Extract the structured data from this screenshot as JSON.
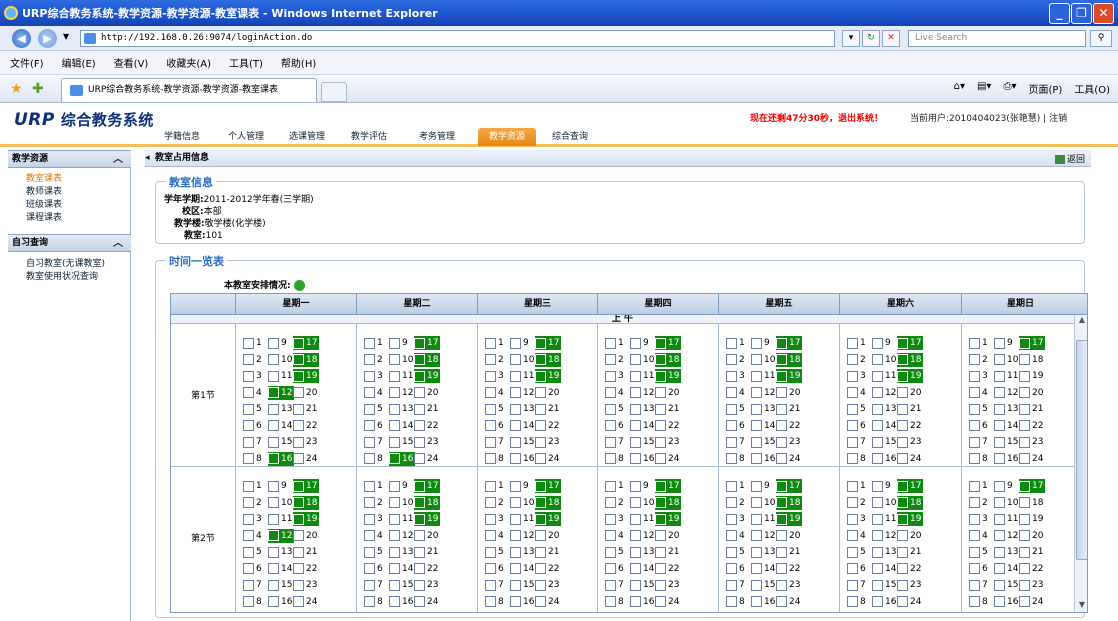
{
  "window": {
    "title": "URP综合教务系统-教学资源-教学资源-教室课表 - Windows Internet Explorer",
    "url": "http://192.168.0.26:9074/loginAction.do",
    "search_placeholder": "Live Search",
    "tab_title": "URP综合教务系统-教学资源-教学资源-教室课表",
    "menu": [
      "文件(F)",
      "编辑(E)",
      "查看(V)",
      "收藏夹(A)",
      "工具(T)",
      "帮助(H)"
    ],
    "toolbar": {
      "page": "页面(P)",
      "tools": "工具(O)"
    }
  },
  "app": {
    "logo_latin": "URP",
    "logo_cn": "综合教务系统",
    "warning": "现在还剩47分30秒，退出系统！",
    "user_text": "当前用户:2010404023(张艳慧) | 注销",
    "nav": [
      "学籍信息",
      "个人管理",
      "选课管理",
      "教学评估",
      "考务管理",
      "教学资源",
      "综合查询"
    ],
    "active_nav": "教学资源"
  },
  "sidebar": {
    "section1_title": "教学资源",
    "section1_items": [
      "教室课表",
      "教师课表",
      "班级课表",
      "课程课表"
    ],
    "section2_title": "自习查询",
    "section2_items": [
      "自习教室(无课教室)",
      "教室使用状况查询"
    ],
    "active_item": "教室课表"
  },
  "content": {
    "header": "教室占用信息",
    "back": "返回",
    "info_legend": "教室信息",
    "term_label": "学年学期:",
    "term": "2011-2012学年春(三学期)",
    "campus_label": "校区:",
    "campus": "本部",
    "building_label": "教学楼:",
    "building": "敬学楼(化学楼)",
    "room_label": "教室:",
    "room": "101",
    "time_legend": "时间一览表",
    "status_label": "本教室安排情况:",
    "status_color": "#2aa52a",
    "days": [
      "星期一",
      "星期二",
      "星期三",
      "星期四",
      "星期五",
      "星期六",
      "星期日"
    ],
    "noon_label": "上 午",
    "periods": [
      "第1节",
      "第2节"
    ],
    "week_checked": {
      "period1": [
        [
          17,
          18,
          19,
          12,
          16
        ],
        [
          17,
          18,
          19,
          16
        ],
        [
          17,
          18,
          19
        ],
        [
          17,
          18,
          19
        ],
        [
          17,
          18,
          19
        ],
        [
          17,
          18,
          19
        ],
        [
          17
        ]
      ],
      "period2": [
        [
          17,
          18,
          19,
          12
        ],
        [
          17,
          18,
          19
        ],
        [
          17,
          18,
          19
        ],
        [
          17,
          18,
          19
        ],
        [
          17,
          18,
          19
        ],
        [
          17,
          18,
          19
        ],
        [
          17
        ]
      ]
    },
    "note_period1_mon_row4": "4 ✓12 ✓20"
  }
}
